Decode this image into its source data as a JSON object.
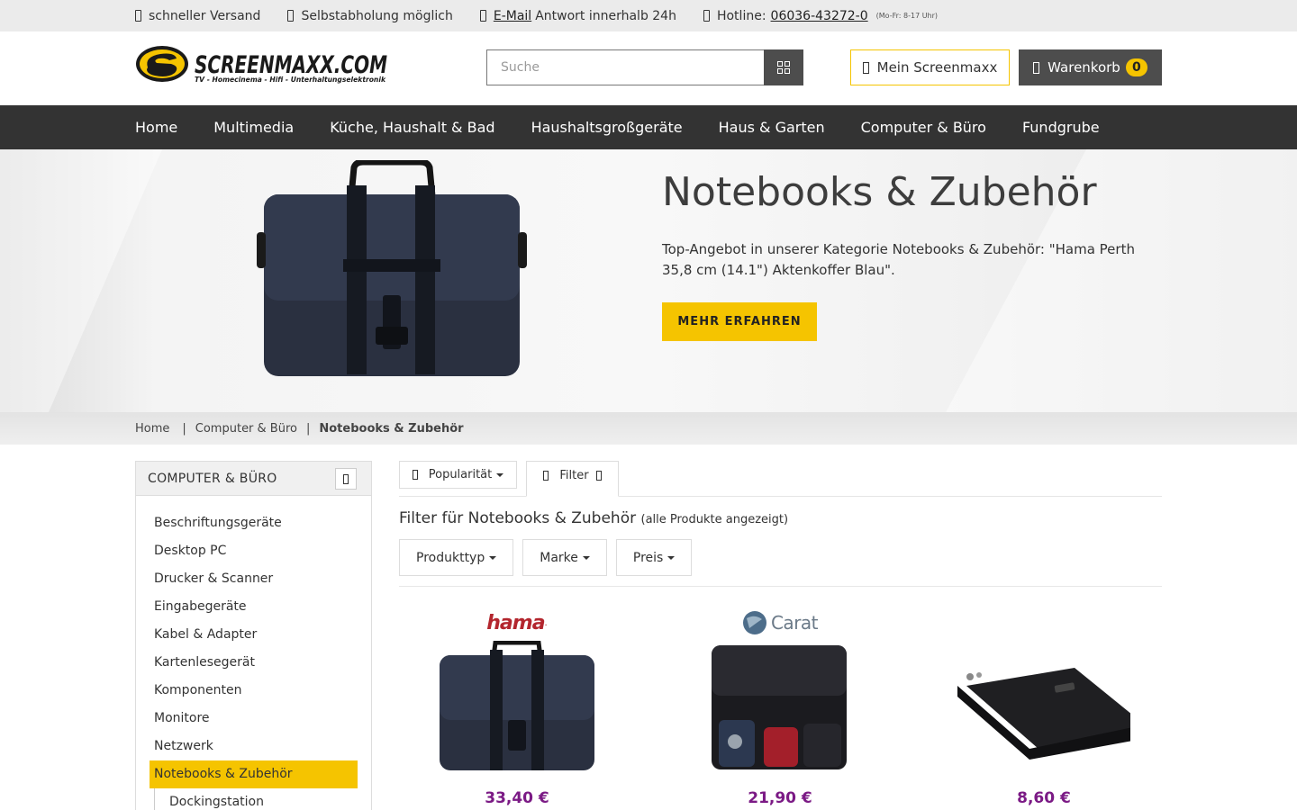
{
  "topbar": {
    "shipping": "schneller Versand",
    "pickup": "Selbstabholung möglich",
    "email_link": "E-Mail",
    "email_text": "Antwort innerhalb 24h",
    "hotline_label": "Hotline:",
    "hotline_number": "06036-43272-0",
    "hotline_hours": "(Mo-Fr: 8-17 Uhr)"
  },
  "header": {
    "logo_text": "SCREENMAXX.COM",
    "logo_tagline": "TV - Homecinema - Hifi - Unterhaltungselektronik",
    "search_placeholder": "Suche",
    "account_label": "Mein Screenmaxx",
    "cart_label": "Warenkorb",
    "cart_count": "0"
  },
  "nav": [
    "Home",
    "Multimedia",
    "Küche, Haushalt & Bad",
    "Haushaltsgroßgeräte",
    "Haus & Garten",
    "Computer & Büro",
    "Fundgrube"
  ],
  "hero": {
    "title": "Notebooks & Zubehör",
    "text": "Top-Angebot in unserer Kategorie Notebooks & Zubehör: \"Hama Perth 35,8 cm (14.1\") Aktenkoffer Blau\".",
    "button": "MEHR ERFAHREN"
  },
  "breadcrumb": [
    "Home",
    "Computer & Büro",
    "Notebooks & Zubehör"
  ],
  "sidebar": {
    "title": "COMPUTER & BÜRO",
    "items": [
      "Beschriftungsgeräte",
      "Desktop PC",
      "Drucker & Scanner",
      "Eingabegeräte",
      "Kabel & Adapter",
      "Kartenlesegerät",
      "Komponenten",
      "Monitore",
      "Netzwerk",
      "Notebooks & Zubehör"
    ],
    "subitems": [
      "Dockingstation"
    ]
  },
  "toolbar": {
    "sort_label": "Popularität",
    "filter_label": "Filter"
  },
  "filter": {
    "heading": "Filter für Notebooks & Zubehör",
    "sub": "(alle Produkte angezeigt)",
    "buttons": [
      "Produkttyp",
      "Marke",
      "Preis"
    ]
  },
  "products": [
    {
      "brand": "hama",
      "price": "33,40 €"
    },
    {
      "brand": "Carat",
      "price": "21,90 €"
    },
    {
      "brand": "",
      "price": "8,60 €"
    }
  ],
  "colors": {
    "accent": "#f5c400",
    "nav_bg": "#333333",
    "price": "#7b1a85"
  }
}
